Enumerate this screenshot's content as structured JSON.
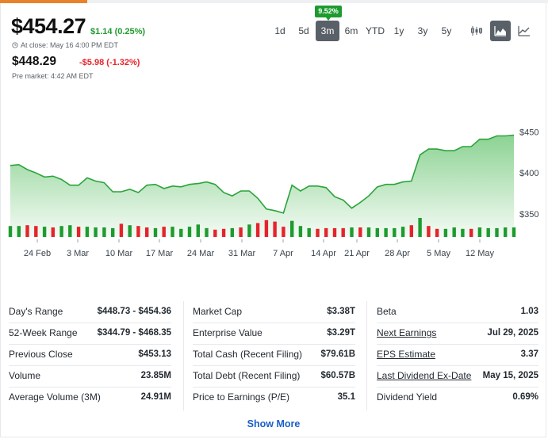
{
  "quote": {
    "price": "$454.27",
    "change": "$1.14 (0.25%)",
    "close_label": "At close: May 16 4:00 PM EDT",
    "premarket_price": "$448.29",
    "premarket_change": "-$5.98 (-1.32%)",
    "premarket_label": "Pre market: 4:42 AM EDT"
  },
  "range_selector": {
    "badge": "9.52%",
    "options": [
      "1d",
      "5d",
      "3m",
      "6m",
      "YTD",
      "1y",
      "3y",
      "5y"
    ],
    "active": "3m"
  },
  "chart_type_icons": [
    "candlestick-icon",
    "mountain-icon",
    "line-icon"
  ],
  "colors": {
    "up": "#1e9b2f",
    "down": "#e6232b",
    "area": "#2eae3a",
    "line": "#2aa43a"
  },
  "chart_data": {
    "type": "area",
    "x_ticks": [
      "24 Feb",
      "3 Mar",
      "10 Mar",
      "17 Mar",
      "24 Mar",
      "31 Mar",
      "7 Apr",
      "14 Apr",
      "21 Apr",
      "28 Apr",
      "5 May",
      "12 May"
    ],
    "y_ticks": [
      "$450",
      "$400",
      "$350"
    ],
    "ylim": [
      322,
      460
    ],
    "values": [
      409,
      410,
      404,
      400,
      395,
      396,
      392,
      385,
      385,
      394,
      390,
      388,
      377,
      377,
      380,
      376,
      385,
      386,
      381,
      384,
      383,
      386,
      387,
      389,
      386,
      376,
      372,
      378,
      378,
      369,
      356,
      354,
      351,
      385,
      378,
      384,
      384,
      382,
      371,
      367,
      357,
      364,
      372,
      383,
      386,
      386,
      389,
      390,
      422,
      429,
      429,
      427,
      427,
      432,
      432,
      441,
      441,
      445,
      445,
      446
    ],
    "volume_dir": [
      "u",
      "u",
      "d",
      "d",
      "u",
      "d",
      "u",
      "u",
      "d",
      "u",
      "u",
      "u",
      "u",
      "d",
      "u",
      "d",
      "d",
      "u",
      "d",
      "u",
      "u",
      "u",
      "u",
      "u",
      "d",
      "d",
      "u",
      "d",
      "u",
      "d",
      "d",
      "d",
      "d",
      "u",
      "u",
      "u",
      "d",
      "d",
      "d",
      "d",
      "u",
      "d",
      "u",
      "u",
      "u",
      "u",
      "u",
      "d",
      "u",
      "d",
      "d",
      "u",
      "u",
      "u",
      "d",
      "u",
      "u",
      "u",
      "u",
      "u"
    ],
    "volume": [
      30,
      30,
      32,
      30,
      28,
      26,
      30,
      32,
      28,
      28,
      26,
      26,
      24,
      36,
      32,
      30,
      26,
      24,
      28,
      28,
      22,
      28,
      34,
      24,
      20,
      22,
      24,
      26,
      34,
      38,
      46,
      42,
      28,
      44,
      30,
      24,
      22,
      24,
      24,
      24,
      26,
      26,
      26,
      24,
      24,
      24,
      28,
      32,
      52,
      30,
      22,
      22,
      26,
      22,
      22,
      26,
      24,
      24,
      26,
      26
    ],
    "grid": false,
    "legend": "none"
  },
  "stats": {
    "col1": [
      {
        "label": "Day's Range",
        "value": "$448.73 - $454.36"
      },
      {
        "label": "52-Week Range",
        "value": "$344.79 - $468.35"
      },
      {
        "label": "Previous Close",
        "value": "$453.13"
      },
      {
        "label": "Volume",
        "value": "23.85M"
      },
      {
        "label": "Average Volume (3M)",
        "value": "24.91M"
      }
    ],
    "col2": [
      {
        "label": "Market Cap",
        "value": "$3.38T"
      },
      {
        "label": "Enterprise Value",
        "value": "$3.29T"
      },
      {
        "label": "Total Cash (Recent Filing)",
        "value": "$79.61B"
      },
      {
        "label": "Total Debt (Recent Filing)",
        "value": "$60.57B"
      },
      {
        "label": "Price to Earnings (P/E)",
        "value": "35.1"
      }
    ],
    "col3": [
      {
        "label": "Beta",
        "value": "1.03",
        "link": false
      },
      {
        "label": "Next Earnings",
        "value": "Jul 29, 2025",
        "link": true
      },
      {
        "label": "EPS Estimate",
        "value": "3.37",
        "link": true
      },
      {
        "label": "Last Dividend Ex-Date",
        "value": "May 15, 2025",
        "link": true
      },
      {
        "label": "Dividend Yield",
        "value": "0.69%",
        "link": false
      }
    ]
  },
  "show_more_label": "Show More"
}
